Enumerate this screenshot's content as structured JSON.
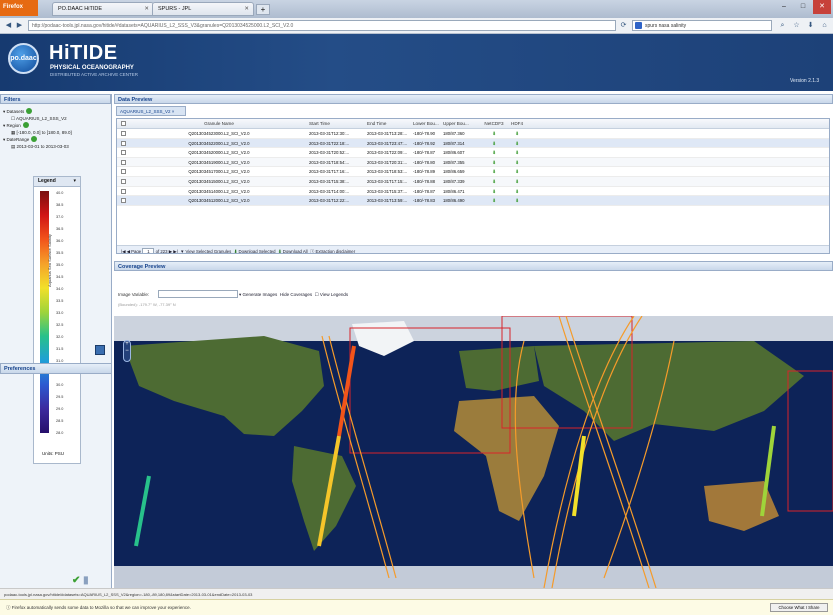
{
  "browser": {
    "app_button": "Firefox",
    "tabs": [
      {
        "label": "PO.DAAC HiTIDE"
      },
      {
        "label": "SPURS - JPL"
      }
    ],
    "url": "http://podaac-tools.jpl.nasa.gov/hitide/#datasets=AQUARIUS_L2_SSS_V3&granules=Q2013034525000.L2_SCI_V2.0",
    "search_value": "spurs nasa salinity",
    "window_controls": [
      "–",
      "□",
      "✕"
    ]
  },
  "header": {
    "logo_text": "po.daac",
    "title": "HiTIDE",
    "subtitle": "PHYSICAL OCEANOGRAPHY",
    "subtitle2": "DISTRIBUTED ACTIVE ARCHIVE CENTER",
    "version": "Version 2.1.3"
  },
  "filters": {
    "title": "Filters",
    "dataset_label": "Datasets",
    "dataset_value": "AQUARIUS_L2_SSS_V2",
    "region_label": "Region",
    "region_value": "[-180.0, 0.0] to [180.0, 89.0]",
    "daterange_label": "DateRange",
    "daterange_value": "2013-03-01 to 2013-03-03"
  },
  "legend": {
    "title": "Legend",
    "variable": "Aquarius Sea Surface Salinity",
    "ticks": [
      "40.0",
      "38.5",
      "37.0",
      "36.5",
      "36.0",
      "35.5",
      "35.0",
      "34.5",
      "34.0",
      "33.5",
      "33.0",
      "32.5",
      "32.0",
      "31.5",
      "31.0",
      "30.5",
      "30.0",
      "29.5",
      "29.0",
      "28.5",
      "28.0"
    ],
    "units": "Units: PSU"
  },
  "preferences": {
    "title": "Preferences"
  },
  "data_preview": {
    "title": "Data Preview",
    "tab": "AQUARIUS_L2_SSS_V2",
    "columns": [
      "Granule Name",
      "Start Time",
      "End Time",
      "Lower Bou...",
      "Upper Bou...",
      "NetCDF3",
      "HDF4"
    ],
    "rows": [
      [
        "Q2013034523000.L2_SCI_V2.0",
        "2013-03-31T12:30:...",
        "2013-03-31T13:28:...",
        "-180/-78.90",
        "180/87.360",
        "⬇",
        "⬇"
      ],
      [
        "Q2013034522000.L2_SCI_V2.0",
        "2013-03-31T22:18:...",
        "2013-03-31T23:47:...",
        "-180/-78.92",
        "180/87.314",
        "⬇",
        "⬇"
      ],
      [
        "Q2013034520000.L2_SCI_V2.0",
        "2013-03-31T20:52:...",
        "2013-03-31T22:09:...",
        "-180/-78.87",
        "180/86.607",
        "⬇",
        "⬇"
      ],
      [
        "Q2013034519000.L2_SCI_V2.0",
        "2013-03-31T18:54:...",
        "2013-03-31T20:31:...",
        "-180/-78.80",
        "180/87.355",
        "⬇",
        "⬇"
      ],
      [
        "Q2013034517000.L2_SCI_V2.0",
        "2013-03-31T17:16:...",
        "2013-03-31T18:53:...",
        "-180/-78.89",
        "180/86.659",
        "⬇",
        "⬇"
      ],
      [
        "Q2013034515000.L2_SCI_V2.0",
        "2013-03-31T15:38:...",
        "2013-03-31T17:15:...",
        "-180/-78.88",
        "180/87.339",
        "⬇",
        "⬇"
      ],
      [
        "Q2013034514000.L2_SCI_V2.0",
        "2013-03-31T14:00:...",
        "2013-03-31T15:37:...",
        "-180/-78.87",
        "180/86.471",
        "⬇",
        "⬇"
      ],
      [
        "Q2013034512000.L2_SCI_V2.0",
        "2013-03-31T12:22:...",
        "2013-03-31T13:59:...",
        "-180/-78.83",
        "180/86.490",
        "⬇",
        "⬇"
      ]
    ],
    "pager": {
      "page_label": "Page",
      "page_value": "1",
      "of": "of 223",
      "view_selected": "View Selected Granules",
      "download_selected": "Download Selected",
      "download_all": "Download All",
      "disclaimer": "Extraction disclaimer"
    }
  },
  "coverage": {
    "title": "Coverage Preview",
    "image_variable_label": "Image Variable:",
    "generate_images": "Generate Images",
    "hide_coverages": "Hide Coverages",
    "view_legends": "View Legends",
    "readout": "(Bounded): -179.7° W, -77.39° N"
  },
  "status_bar": "podaac-tools.jpl.nasa.gov/hitide/#datasets=AQUARIUS_L2_SSS_V2&region=-180,-89,180,89&startDate=2013-03-01&endDate=2013-03-03",
  "notification": {
    "text": "Firefox automatically sends some data to Mozilla so that we can improve your experience.",
    "button": "Choose What I Share"
  },
  "colors": {
    "accent": "#15428b",
    "header_bg": "#1d4178",
    "download_green": "#3a9a2f",
    "swath_orange": "#f59b2a",
    "bbox_red": "#d8232a"
  }
}
